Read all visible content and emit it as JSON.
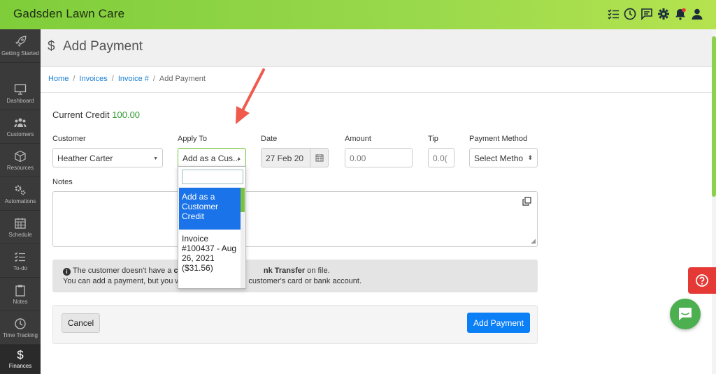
{
  "app": {
    "title": "Gadsden Lawn Care"
  },
  "topbar": {
    "icons": [
      "checklist-icon",
      "clock-icon",
      "chat-icon",
      "gear-icon",
      "bell-icon",
      "user-icon"
    ]
  },
  "sidebar": {
    "items": [
      {
        "label": "Getting Started",
        "icon": "rocket-icon"
      },
      {
        "label": "Dashboard",
        "icon": "monitor-icon"
      },
      {
        "label": "Customers",
        "icon": "people-icon"
      },
      {
        "label": "Resources",
        "icon": "cube-icon"
      },
      {
        "label": "Automations",
        "icon": "gears-icon"
      },
      {
        "label": "Schedule",
        "icon": "calendar-icon"
      },
      {
        "label": "To-do",
        "icon": "todo-icon"
      },
      {
        "label": "Notes",
        "icon": "clipboard-icon"
      },
      {
        "label": "Time Tracking",
        "icon": "clock-icon"
      },
      {
        "label": "Finances",
        "icon": "dollar-icon"
      }
    ]
  },
  "header": {
    "icon": "$",
    "title": "Add Payment"
  },
  "breadcrumb": {
    "home": "Home",
    "invoices": "Invoices",
    "invoice": "Invoice #",
    "current": "Add Payment"
  },
  "credit": {
    "label": "Current Credit",
    "value": "100.00"
  },
  "form": {
    "customer": {
      "label": "Customer",
      "value": "Heather Carter"
    },
    "apply_to": {
      "label": "Apply To",
      "value": "Add as a Cus..."
    },
    "date": {
      "label": "Date",
      "value": "27 Feb 20"
    },
    "amount": {
      "label": "Amount",
      "placeholder": "0.00"
    },
    "tip": {
      "label": "Tip",
      "placeholder": "0.0("
    },
    "payment_method": {
      "label": "Payment Method",
      "value": "Select Metho"
    },
    "notes": {
      "label": "Notes"
    }
  },
  "dropdown": {
    "search_value": "",
    "options": [
      {
        "label": "Add as a Customer Credit",
        "selected": true
      },
      {
        "label": "Invoice #100437 - Aug 26, 2021 ($31.56)",
        "selected": false
      }
    ]
  },
  "alert": {
    "line1_a": "The customer doesn't have a ",
    "line1_b": "cr",
    "line1_c": "nk Transfer",
    "line1_d": " on file.",
    "line2_a": "You can add a payment, but you wi",
    "line2_b": "rge",
    "line2_c": " the customer's card or bank account."
  },
  "buttons": {
    "cancel": "Cancel",
    "add_payment": "Add Payment"
  },
  "colors": {
    "topbar": "#8fd34a",
    "primary": "#0b7ff5",
    "selected": "#1a73e8",
    "credit_value": "#2e9a2e",
    "help": "#e53935",
    "chat": "#4caf50",
    "arrow": "#ef5a4c"
  }
}
